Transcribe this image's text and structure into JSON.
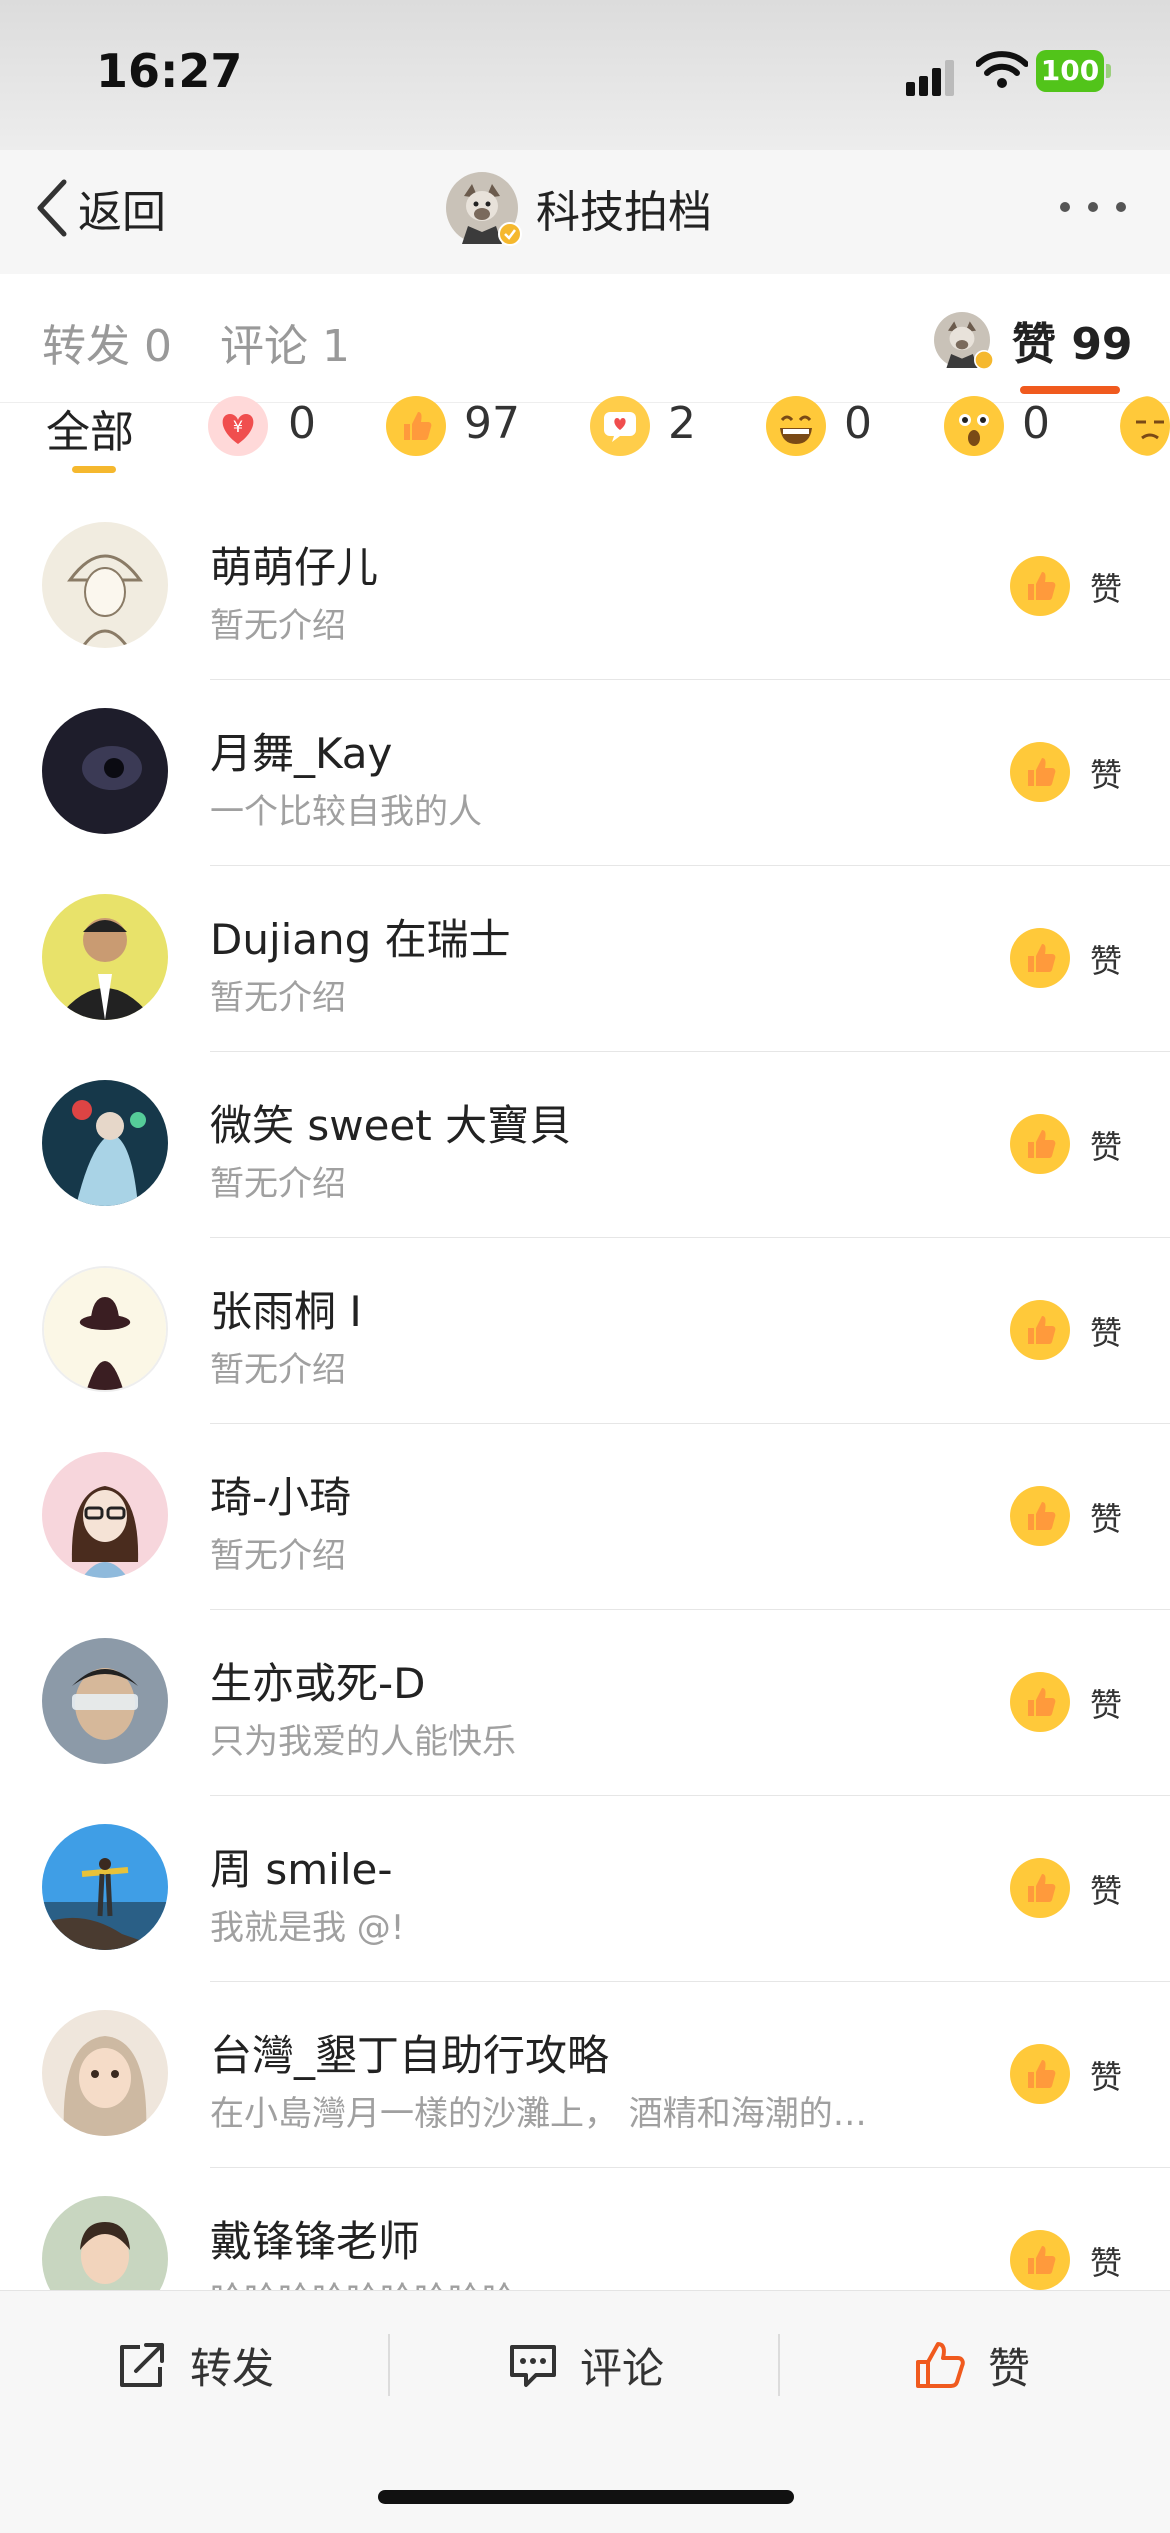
{
  "status_bar": {
    "time": "16:27",
    "battery": "100"
  },
  "nav": {
    "back_label": "返回",
    "title": "科技拍档"
  },
  "tabs": {
    "repost": "转发 0",
    "comment": "评论 1",
    "like": "赞 99"
  },
  "reaction_filters": {
    "all": "全部",
    "items": [
      {
        "icon": "heart-yen-icon",
        "count": "0"
      },
      {
        "icon": "thumbs-up-icon",
        "count": "97"
      },
      {
        "icon": "heart-bubble-icon",
        "count": "2"
      },
      {
        "icon": "laughing-face-icon",
        "count": "0"
      },
      {
        "icon": "surprised-face-icon",
        "count": "0"
      }
    ]
  },
  "likers": [
    {
      "name": "萌萌仔儿",
      "desc": "暂无介绍",
      "action": "赞"
    },
    {
      "name": "月舞_Kay",
      "desc": "一个比较自我的人",
      "action": "赞"
    },
    {
      "name": "Dujiang 在瑞士",
      "desc": "暂无介绍",
      "action": "赞"
    },
    {
      "name": "微笑 sweet 大寶貝",
      "desc": "暂无介绍",
      "action": "赞"
    },
    {
      "name": "张雨桐 I",
      "desc": "暂无介绍",
      "action": "赞"
    },
    {
      "name": "琦-小琦",
      "desc": "暂无介绍",
      "action": "赞"
    },
    {
      "name": "生亦或死-D",
      "desc": "只为我爱的人能快乐",
      "action": "赞"
    },
    {
      "name": "周 smile-",
      "desc": "我就是我 @!",
      "action": "赞"
    },
    {
      "name": "台灣_墾丁自助行攻略",
      "desc": "在小島灣月一樣的沙灘上， 酒精和海潮的…",
      "action": "赞"
    },
    {
      "name": "戴锋锋老师",
      "desc": "哈哈哈哈哈哈哈哈哈",
      "action": "赞"
    }
  ],
  "toolbar": {
    "repost": "转发",
    "comment": "评论",
    "like": "赞"
  },
  "colors": {
    "accent": "#f05a1e",
    "like_yellow": "#f5b82e",
    "muted_text": "#a0a0a0"
  }
}
